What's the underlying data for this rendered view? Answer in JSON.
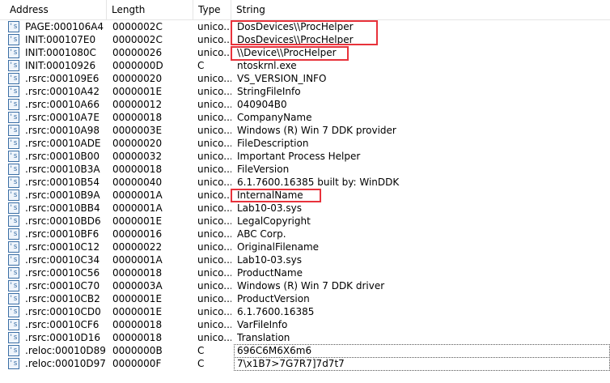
{
  "columns": {
    "address": "Address",
    "length": "Length",
    "type": "Type",
    "string": "String"
  },
  "icon": {
    "name": "string-icon",
    "glyph": "'s'"
  },
  "rows": [
    {
      "address": "PAGE:000106A4",
      "length": "0000002C",
      "type": "unico...",
      "string": "DosDevices\\\\ProcHelper"
    },
    {
      "address": "INIT:000107E0",
      "length": "0000002C",
      "type": "unico...",
      "string": "DosDevices\\\\ProcHelper"
    },
    {
      "address": "INIT:0001080C",
      "length": "00000026",
      "type": "unico...",
      "string": "\\\\Device\\\\ProcHelper"
    },
    {
      "address": "INIT:00010926",
      "length": "0000000D",
      "type": "C",
      "string": "ntoskrnl.exe"
    },
    {
      "address": ".rsrc:000109E6",
      "length": "00000020",
      "type": "unico...",
      "string": "VS_VERSION_INFO"
    },
    {
      "address": ".rsrc:00010A42",
      "length": "0000001E",
      "type": "unico...",
      "string": "StringFileInfo"
    },
    {
      "address": ".rsrc:00010A66",
      "length": "00000012",
      "type": "unico...",
      "string": "040904B0"
    },
    {
      "address": ".rsrc:00010A7E",
      "length": "00000018",
      "type": "unico...",
      "string": "CompanyName"
    },
    {
      "address": ".rsrc:00010A98",
      "length": "0000003E",
      "type": "unico...",
      "string": "Windows (R) Win 7 DDK provider"
    },
    {
      "address": ".rsrc:00010ADE",
      "length": "00000020",
      "type": "unico...",
      "string": "FileDescription"
    },
    {
      "address": ".rsrc:00010B00",
      "length": "00000032",
      "type": "unico...",
      "string": "Important Process Helper"
    },
    {
      "address": ".rsrc:00010B3A",
      "length": "00000018",
      "type": "unico...",
      "string": "FileVersion"
    },
    {
      "address": ".rsrc:00010B54",
      "length": "00000040",
      "type": "unico...",
      "string": "6.1.7600.16385 built by: WinDDK"
    },
    {
      "address": ".rsrc:00010B9A",
      "length": "0000001A",
      "type": "unico...",
      "string": "InternalName"
    },
    {
      "address": ".rsrc:00010BB4",
      "length": "0000001A",
      "type": "unico...",
      "string": "Lab10-03.sys"
    },
    {
      "address": ".rsrc:00010BD6",
      "length": "0000001E",
      "type": "unico...",
      "string": "LegalCopyright"
    },
    {
      "address": ".rsrc:00010BF6",
      "length": "00000016",
      "type": "unico...",
      "string": " ABC Corp."
    },
    {
      "address": ".rsrc:00010C12",
      "length": "00000022",
      "type": "unico...",
      "string": "OriginalFilename"
    },
    {
      "address": ".rsrc:00010C34",
      "length": "0000001A",
      "type": "unico...",
      "string": "Lab10-03.sys"
    },
    {
      "address": ".rsrc:00010C56",
      "length": "00000018",
      "type": "unico...",
      "string": "ProductName"
    },
    {
      "address": ".rsrc:00010C70",
      "length": "0000003A",
      "type": "unico...",
      "string": "Windows (R) Win 7 DDK driver"
    },
    {
      "address": ".rsrc:00010CB2",
      "length": "0000001E",
      "type": "unico...",
      "string": "ProductVersion"
    },
    {
      "address": ".rsrc:00010CD0",
      "length": "0000001E",
      "type": "unico...",
      "string": "6.1.7600.16385"
    },
    {
      "address": ".rsrc:00010CF6",
      "length": "00000018",
      "type": "unico...",
      "string": "VarFileInfo"
    },
    {
      "address": ".rsrc:00010D16",
      "length": "00000018",
      "type": "unico...",
      "string": "Translation"
    },
    {
      "address": ".reloc:00010D89",
      "length": "0000000B",
      "type": "C",
      "string": "696C6M6X6m6"
    },
    {
      "address": ".reloc:00010D97",
      "length": "0000000F",
      "type": "C",
      "string": "7\\x1B7>7G7R7]7d7t7"
    }
  ],
  "colors": {
    "highlight": "#e8323b",
    "icon_border": "#3a6ea5"
  }
}
